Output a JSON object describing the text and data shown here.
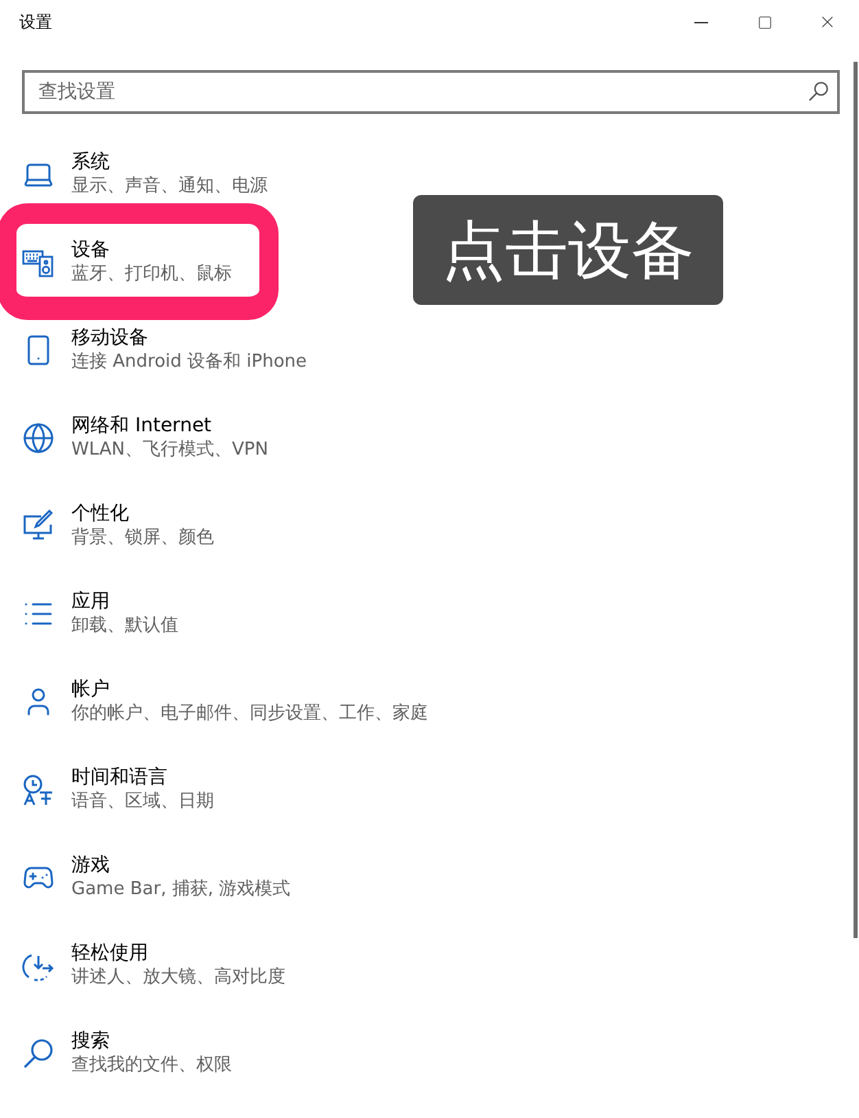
{
  "window": {
    "title": "设置"
  },
  "search": {
    "placeholder": "查找设置"
  },
  "items": [
    {
      "title": "系统",
      "description": "显示、声音、通知、电源",
      "highlighted": false
    },
    {
      "title": "设备",
      "description": "蓝牙、打印机、鼠标",
      "highlighted": true
    },
    {
      "title": "移动设备",
      "description": "连接 Android 设备和 iPhone",
      "highlighted": false
    },
    {
      "title": "网络和 Internet",
      "description": "WLAN、飞行模式、VPN",
      "highlighted": false
    },
    {
      "title": "个性化",
      "description": "背景、锁屏、颜色",
      "highlighted": false
    },
    {
      "title": "应用",
      "description": "卸载、默认值",
      "highlighted": false
    },
    {
      "title": "帐户",
      "description": "你的帐户、电子邮件、同步设置、工作、家庭",
      "highlighted": false
    },
    {
      "title": "时间和语言",
      "description": "语音、区域、日期",
      "highlighted": false
    },
    {
      "title": "游戏",
      "description": "Game Bar, 捕获, 游戏模式",
      "highlighted": false
    },
    {
      "title": "轻松使用",
      "description": "讲述人、放大镜、高对比度",
      "highlighted": false
    },
    {
      "title": "搜索",
      "description": "查找我的文件、权限",
      "highlighted": false
    }
  ],
  "callout": {
    "text": "点击设备"
  }
}
